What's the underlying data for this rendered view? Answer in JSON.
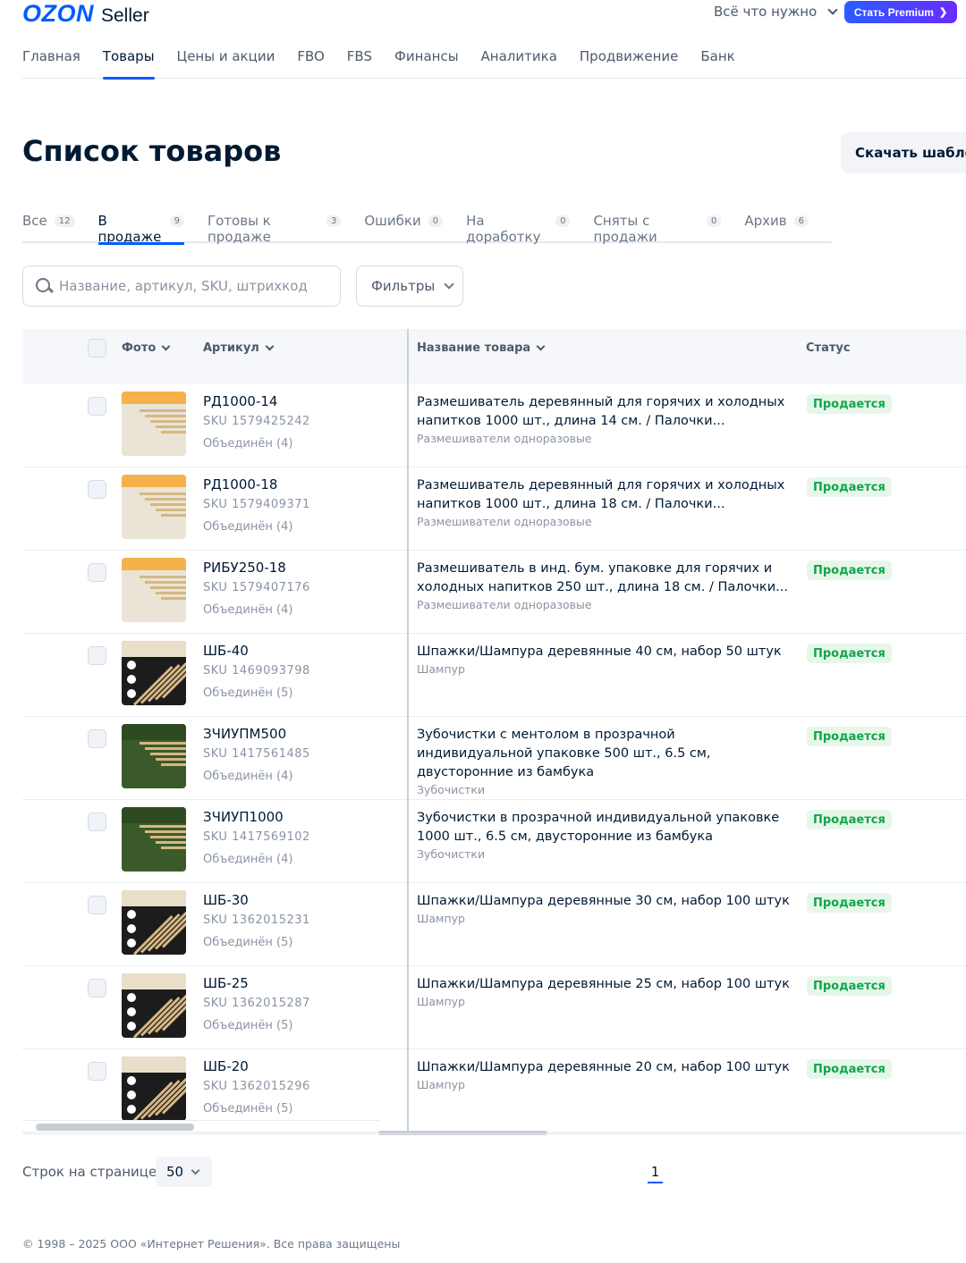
{
  "header": {
    "logo_brand": "OZON",
    "logo_product": "Seller",
    "top_search_label": "Всё что нужно",
    "premium_label": "Стать Premium",
    "premium_color": "#005bff"
  },
  "nav": {
    "items": [
      "Главная",
      "Товары",
      "Цены и акции",
      "FBO",
      "FBS",
      "Финансы",
      "Аналитика",
      "Продвижение",
      "Банк"
    ],
    "active": "Товары"
  },
  "page": {
    "title": "Список товаров",
    "download_label": "Скачать шаблон"
  },
  "tabs": [
    {
      "label": "Все",
      "count": "12"
    },
    {
      "label": "В продаже",
      "count": "9",
      "active": true
    },
    {
      "label": "Готовы к продаже",
      "count": "3"
    },
    {
      "label": "Ошибки",
      "count": "0"
    },
    {
      "label": "На доработку",
      "count": "0"
    },
    {
      "label": "Сняты с продажи",
      "count": "0"
    },
    {
      "label": "Архив",
      "count": "6"
    }
  ],
  "search": {
    "placeholder": "Название, артикул, SKU, штрихкод",
    "value": ""
  },
  "filters_label": "Фильтры",
  "table": {
    "headers": {
      "photo": "Фото",
      "article": "Артикул",
      "name": "Название товара",
      "status": "Статус"
    },
    "rows": [
      {
        "article": "РД1000-14",
        "sku": "SKU 1579425242",
        "merged": "Объединён (4)",
        "name": "Размешиватель деревянный для горячих и холодных напитков 1000 шт., длина 14 см. / Палочки...",
        "category": "Размешиватели одноразовые",
        "status": "Продается",
        "thumb": "light"
      },
      {
        "article": "РД1000-18",
        "sku": "SKU 1579409371",
        "merged": "Объединён (4)",
        "name": "Размешиватель деревянный для горячих и холодных напитков 1000 шт., длина 18 см. / Палочки...",
        "category": "Размешиватели одноразовые",
        "status": "Продается",
        "thumb": "light"
      },
      {
        "article": "РИБУ250-18",
        "sku": "SKU 1579407176",
        "merged": "Объединён (4)",
        "name": "Размешиватель в инд. бум. упаковке для горячих и холодных напитков 250 шт., длина 18 см. / Палочки...",
        "category": "Размешиватели одноразовые",
        "status": "Продается",
        "thumb": "light"
      },
      {
        "article": "ШБ-40",
        "sku": "SKU 1469093798",
        "merged": "Объединён (5)",
        "name": "Шпажки/Шампура деревянные 40 см, набор 50 штук",
        "category": "Шампур",
        "status": "Продается",
        "thumb": "dark"
      },
      {
        "article": "ЗЧИУПМ500",
        "sku": "SKU 1417561485",
        "merged": "Объединён (4)",
        "name": "Зубочистки с ментолом в прозрачной индивидуальной упаковке 500 шт., 6.5 см, двусторонние из бамбука",
        "category": "Зубочистки",
        "status": "Продается",
        "thumb": "green"
      },
      {
        "article": "ЗЧИУП1000",
        "sku": "SKU 1417569102",
        "merged": "Объединён (4)",
        "name": "Зубочистки в прозрачной индивидуальной упаковке 1000 шт., 6.5 см, двусторонние из бамбука",
        "category": "Зубочистки",
        "status": "Продается",
        "thumb": "green"
      },
      {
        "article": "ШБ-30",
        "sku": "SKU 1362015231",
        "merged": "Объединён (5)",
        "name": "Шпажки/Шампура деревянные 30 см, набор 100 штук",
        "category": "Шампур",
        "status": "Продается",
        "thumb": "dark"
      },
      {
        "article": "ШБ-25",
        "sku": "SKU 1362015287",
        "merged": "Объединён (5)",
        "name": "Шпажки/Шампура деревянные 25 см, набор 100 штук",
        "category": "Шампур",
        "status": "Продается",
        "thumb": "dark"
      },
      {
        "article": "ШБ-20",
        "sku": "SKU 1362015296",
        "merged": "Объединён (5)",
        "name": "Шпажки/Шампура деревянные 20 см, набор 100 штук",
        "category": "Шампур",
        "status": "Продается",
        "thumb": "dark"
      }
    ]
  },
  "pagination": {
    "rows_label": "Строк на странице:",
    "rows_value": "50",
    "current_page": "1"
  },
  "footer": {
    "copyright": "© 1998 – 2025 ООО «Интернет Решения». Все права защищены"
  },
  "colors": {
    "accent": "#005bff",
    "status_bg": "#e6f7ea",
    "status_text": "#10a64a"
  }
}
